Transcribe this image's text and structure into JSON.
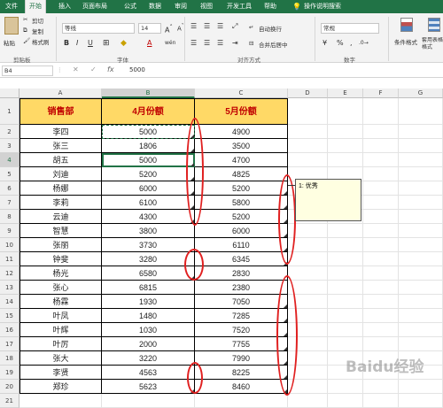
{
  "ribbon_tabs": [
    "文件",
    "开始",
    "插入",
    "页面布局",
    "公式",
    "数据",
    "审阅",
    "视图",
    "开发工具",
    "帮助",
    "操作说明搜索"
  ],
  "clipboard": {
    "paste": "粘贴",
    "cut": "剪切",
    "copy": "复制",
    "format_painter": "格式刷",
    "label": "剪贴板"
  },
  "font": {
    "name": "等线",
    "size": "14",
    "label": "字体",
    "bold": "B",
    "italic": "I",
    "underline": "U",
    "font_color_glyph": "A",
    "wen_glyph": "wén"
  },
  "alignment": {
    "wrap": "自动换行",
    "merge": "合并后居中",
    "label": "对齐方式"
  },
  "number": {
    "format": "常规",
    "label": "数字",
    "percent": "%",
    "comma": ","
  },
  "styles": {
    "conditional": "条件格式",
    "table": "套用表格格式"
  },
  "name_box": "B4",
  "formula_value": "5000",
  "columns": [
    "A",
    "B",
    "C",
    "D",
    "E",
    "F",
    "G"
  ],
  "rows": [
    "1",
    "2",
    "3",
    "4",
    "5",
    "6",
    "7",
    "8",
    "9",
    "10",
    "11",
    "12",
    "13",
    "14",
    "15",
    "16",
    "17",
    "18",
    "19",
    "20",
    "21"
  ],
  "table": {
    "headers": [
      "销售部",
      "4月份额",
      "5月份额"
    ],
    "data": [
      [
        "李四",
        "5000",
        "4900"
      ],
      [
        "张三",
        "1806",
        "3500"
      ],
      [
        "胡五",
        "5000",
        "4700"
      ],
      [
        "刘迪",
        "5200",
        "4825"
      ],
      [
        "杨娜",
        "6000",
        "5200"
      ],
      [
        "李莉",
        "6100",
        "5800"
      ],
      [
        "云迪",
        "4300",
        "5200"
      ],
      [
        "智慧",
        "3800",
        "6000"
      ],
      [
        "张丽",
        "3730",
        "6110"
      ],
      [
        "钟斐",
        "3280",
        "6345"
      ],
      [
        "杨光",
        "6580",
        "2830"
      ],
      [
        "张心",
        "6815",
        "2380"
      ],
      [
        "杨霖",
        "1930",
        "7050"
      ],
      [
        "叶凤",
        "1480",
        "7285"
      ],
      [
        "叶辉",
        "1030",
        "7520"
      ],
      [
        "叶厉",
        "2000",
        "7755"
      ],
      [
        "张大",
        "3220",
        "7990"
      ],
      [
        "李贤",
        "4563",
        "8225"
      ],
      [
        "郑珍",
        "5623",
        "8460"
      ]
    ]
  },
  "comment": {
    "text": "1: 优秀"
  },
  "watermark": "Baidu经验"
}
